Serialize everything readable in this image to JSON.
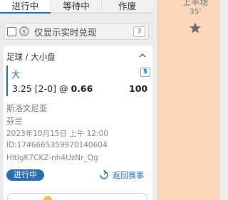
{
  "tabs": [
    {
      "label": "进行中"
    },
    {
      "label": "等待中"
    },
    {
      "label": "作废"
    }
  ],
  "realtime_filter": {
    "label": "仅显示实时兑现",
    "help": "?"
  },
  "bet": {
    "market": "足球 / 大小盘",
    "selection": "大",
    "currency_badge": "$",
    "line": "3.25 [2-0] @",
    "odds": "0.66",
    "stake": "100",
    "home_team": "斯洛文尼亚",
    "away_team": "芬兰",
    "datetime": "2023年10月15日 上午 12:00",
    "id": "ID:1746665359970140604",
    "ref": "HltlgK7CKZ-nh4UzNr_Qg",
    "status": "进行中",
    "return_link": "返回赛事"
  },
  "match": {
    "period": "上半场",
    "minute": "35'"
  },
  "colors": {
    "accent": "#1f6fb8",
    "status_pill": "#2c6fb0",
    "match_panel": "#f9d7bd"
  },
  "icons": [
    "cash-icon",
    "chevron-up-icon",
    "dollar-icon",
    "return-icon",
    "star-icon",
    "coin-icon"
  ]
}
